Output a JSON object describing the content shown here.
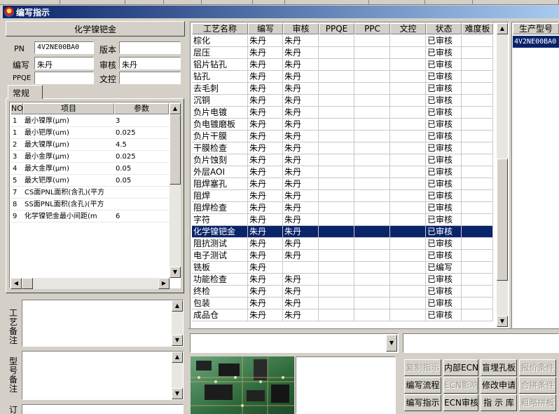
{
  "window": {
    "title": "编写指示"
  },
  "left_panel": {
    "header": "化学镍钯金",
    "pn_label": "PN",
    "pn_value": "4V2NE00BA0",
    "version_label": "版本",
    "version_value": "",
    "writer_label": "编写",
    "writer_value": "朱丹",
    "reviewer_label": "审核",
    "reviewer_value": "朱丹",
    "ppqe_label": "PPQE",
    "ppqe_value": "",
    "document_control_label": "文控",
    "document_control_value": "",
    "tab_label": "常规"
  },
  "params": {
    "columns": [
      "NO",
      "项目",
      "参数"
    ],
    "rows": [
      {
        "no": "1",
        "item": "最小镍厚(μm)",
        "value": "3"
      },
      {
        "no": "1",
        "item": "最小钯厚(um)",
        "value": "0.025"
      },
      {
        "no": "2",
        "item": "最大镍厚(μm)",
        "value": "4.5"
      },
      {
        "no": "3",
        "item": "最小金厚(μm)",
        "value": "0.025"
      },
      {
        "no": "4",
        "item": "最大金厚(μm)",
        "value": "0.05"
      },
      {
        "no": "5",
        "item": "最大钯厚(um)",
        "value": "0.05"
      },
      {
        "no": "7",
        "item": "CS面PNL面积(含孔)(平方",
        "value": ""
      },
      {
        "no": "8",
        "item": "SS面PNL面积(含孔)(平方",
        "value": ""
      },
      {
        "no": "9",
        "item": "化学镍钯金最小间距(m",
        "value": "6"
      }
    ]
  },
  "notes": {
    "process_note_label": "工艺备注",
    "model_note_label": "型号备注",
    "order_note_label": "订"
  },
  "process_table": {
    "columns": [
      "工艺名称",
      "编写",
      "审核",
      "PPQE",
      "PPC",
      "文控",
      "状态",
      "难度板"
    ],
    "selected_index": 16,
    "rows": [
      {
        "name": "棕化",
        "writer": "朱丹",
        "reviewer": "朱丹",
        "status": "已审核"
      },
      {
        "name": "层压",
        "writer": "朱丹",
        "reviewer": "朱丹",
        "status": "已审核"
      },
      {
        "name": "铝片钻孔",
        "writer": "朱丹",
        "reviewer": "朱丹",
        "status": "已审核"
      },
      {
        "name": "钻孔",
        "writer": "朱丹",
        "reviewer": "朱丹",
        "status": "已审核"
      },
      {
        "name": "去毛刺",
        "writer": "朱丹",
        "reviewer": "朱丹",
        "status": "已审核"
      },
      {
        "name": "沉铜",
        "writer": "朱丹",
        "reviewer": "朱丹",
        "status": "已审核"
      },
      {
        "name": "负片电镀",
        "writer": "朱丹",
        "reviewer": "朱丹",
        "status": "已审核"
      },
      {
        "name": "负电镀磨板",
        "writer": "朱丹",
        "reviewer": "朱丹",
        "status": "已审核"
      },
      {
        "name": "负片干膜",
        "writer": "朱丹",
        "reviewer": "朱丹",
        "status": "已审核"
      },
      {
        "name": "干膜检查",
        "writer": "朱丹",
        "reviewer": "朱丹",
        "status": "已审核"
      },
      {
        "name": "负片蚀刻",
        "writer": "朱丹",
        "reviewer": "朱丹",
        "status": "已审核"
      },
      {
        "name": "外层AOI",
        "writer": "朱丹",
        "reviewer": "朱丹",
        "status": "已审核"
      },
      {
        "name": "阻焊塞孔",
        "writer": "朱丹",
        "reviewer": "朱丹",
        "status": "已审核"
      },
      {
        "name": "阻焊",
        "writer": "朱丹",
        "reviewer": "朱丹",
        "status": "已审核"
      },
      {
        "name": "阻焊检查",
        "writer": "朱丹",
        "reviewer": "朱丹",
        "status": "已审核"
      },
      {
        "name": "字符",
        "writer": "朱丹",
        "reviewer": "朱丹",
        "status": "已审核"
      },
      {
        "name": "化学镍钯金",
        "writer": "朱丹",
        "reviewer": "朱丹",
        "status": "已审核"
      },
      {
        "name": "阻抗测试",
        "writer": "朱丹",
        "reviewer": "朱丹",
        "status": "已审核"
      },
      {
        "name": "电子测试",
        "writer": "朱丹",
        "reviewer": "朱丹",
        "status": "已审核"
      },
      {
        "name": "铣板",
        "writer": "朱丹",
        "reviewer": "",
        "status": "已编写"
      },
      {
        "name": "功能检查",
        "writer": "朱丹",
        "reviewer": "朱丹",
        "status": "已审核"
      },
      {
        "name": "终检",
        "writer": "朱丹",
        "reviewer": "朱丹",
        "status": "已审核"
      },
      {
        "name": "包装",
        "writer": "朱丹",
        "reviewer": "朱丹",
        "status": "已审核"
      },
      {
        "name": "成品仓",
        "writer": "朱丹",
        "reviewer": "朱丹",
        "status": "已审核"
      }
    ]
  },
  "model_list": {
    "header": "生产型号",
    "items": [
      "4V2NE00BA0"
    ]
  },
  "buttons": [
    {
      "label": "复制指示",
      "enabled": false
    },
    {
      "label": "内部ECN",
      "enabled": true
    },
    {
      "label": "盲埋孔板",
      "enabled": true
    },
    {
      "label": "报价条件",
      "enabled": false
    },
    {
      "label": "编写流程",
      "enabled": true
    },
    {
      "label": "ECN影响",
      "enabled": false
    },
    {
      "label": "修改申请",
      "enabled": true
    },
    {
      "label": "合拼条件",
      "enabled": false
    },
    {
      "label": "编写指示",
      "enabled": true
    },
    {
      "label": "ECN审核",
      "enabled": true
    },
    {
      "label": "指 示 库",
      "enabled": true
    },
    {
      "label": "粗略拼板",
      "enabled": false
    }
  ],
  "colors": {
    "selection": "#0a246a",
    "titlebar": "#0a246a",
    "face": "#d4d0c8"
  }
}
